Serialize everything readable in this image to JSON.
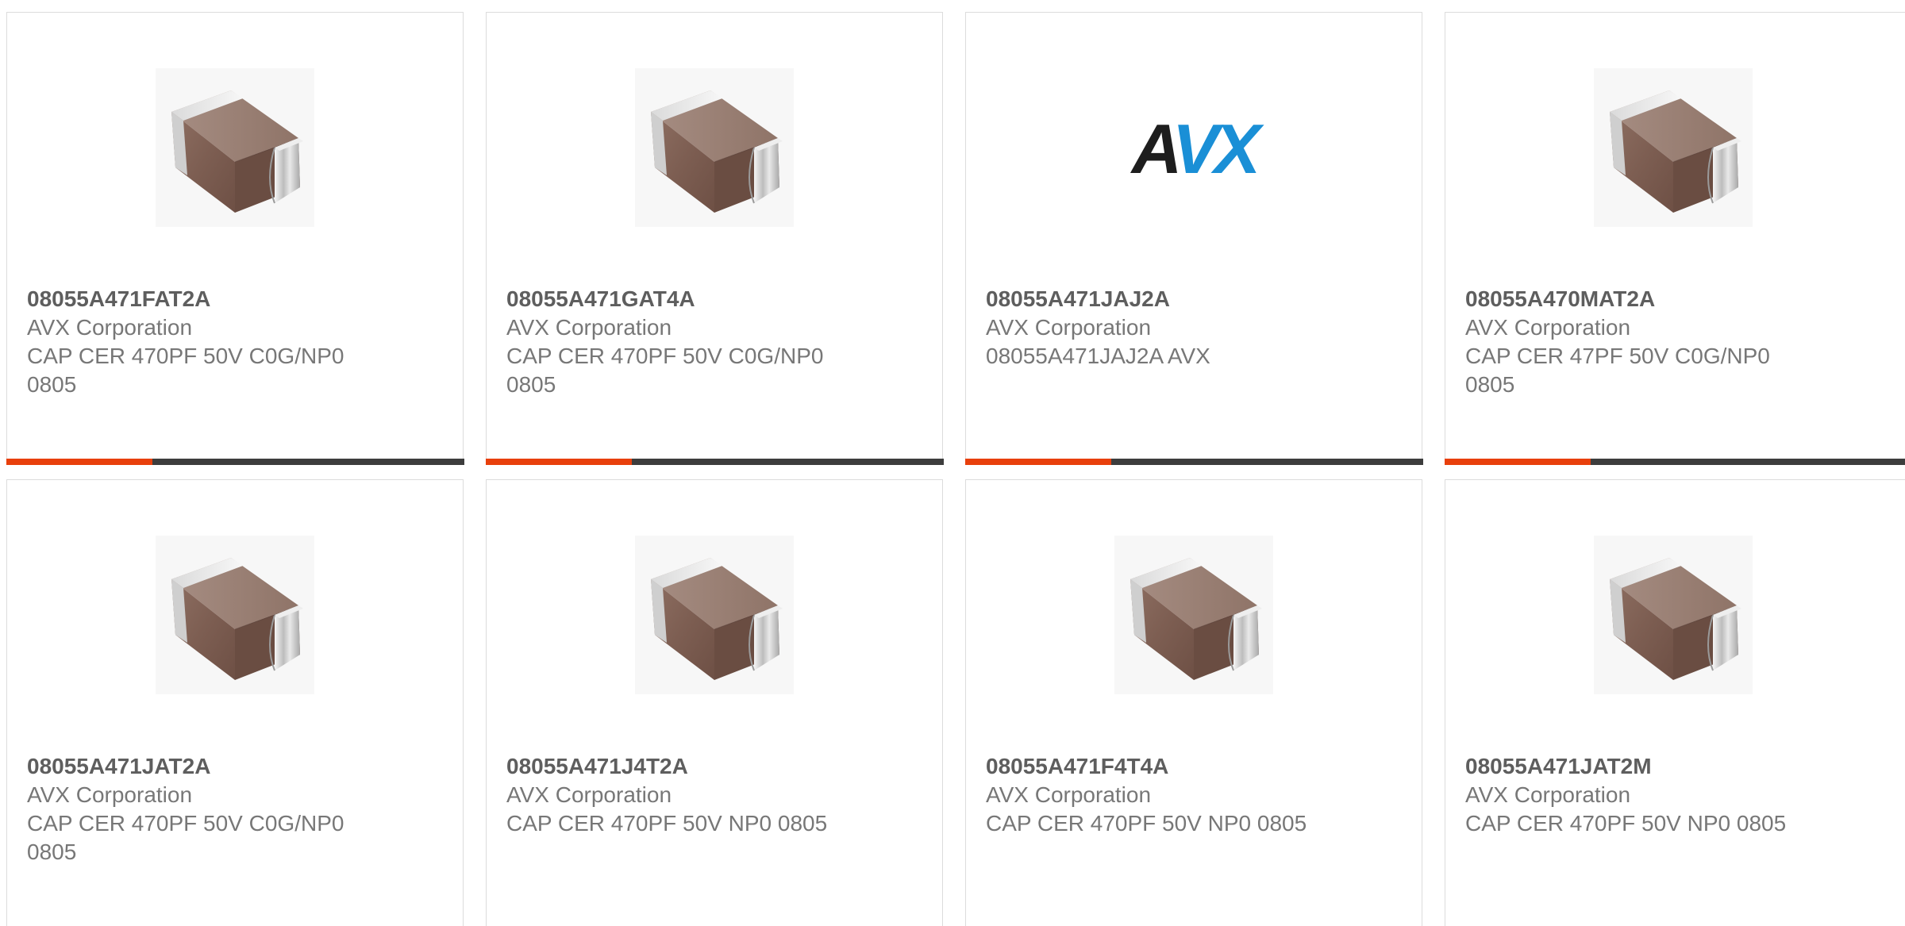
{
  "brand_colors": {
    "accent": "#e8400c",
    "bar_dark": "#3d3d3d",
    "avx_blue": "#1a8fd6",
    "avx_black": "#1e1e1e"
  },
  "cards": [
    {
      "part_number": "08055A471FAT2A",
      "manufacturer": "AVX Corporation",
      "description": "CAP CER 470PF 50V C0G/NP0 0805",
      "image": "ceramic-capacitor-chip"
    },
    {
      "part_number": "08055A471GAT4A",
      "manufacturer": "AVX Corporation",
      "description": "CAP CER 470PF 50V C0G/NP0 0805",
      "image": "ceramic-capacitor-chip"
    },
    {
      "part_number": "08055A471JAJ2A",
      "manufacturer": "AVX Corporation",
      "description": "08055A471JAJ2A AVX",
      "image": "avx-logo",
      "logo_text": "AVX"
    },
    {
      "part_number": "08055A470MAT2A",
      "manufacturer": "AVX Corporation",
      "description": "CAP CER 47PF 50V C0G/NP0 0805",
      "image": "ceramic-capacitor-chip"
    },
    {
      "part_number": "08055A471JAT2A",
      "manufacturer": "AVX Corporation",
      "description": "CAP CER 470PF 50V C0G/NP0 0805",
      "image": "ceramic-capacitor-chip"
    },
    {
      "part_number": "08055A471J4T2A",
      "manufacturer": "AVX Corporation",
      "description": "CAP CER 470PF 50V NP0 0805",
      "image": "ceramic-capacitor-chip"
    },
    {
      "part_number": "08055A471F4T4A",
      "manufacturer": "AVX Corporation",
      "description": "CAP CER 470PF 50V NP0 0805",
      "image": "ceramic-capacitor-chip"
    },
    {
      "part_number": "08055A471JAT2M",
      "manufacturer": "AVX Corporation",
      "description": "CAP CER 470PF 50V NP0 0805",
      "image": "ceramic-capacitor-chip"
    }
  ]
}
